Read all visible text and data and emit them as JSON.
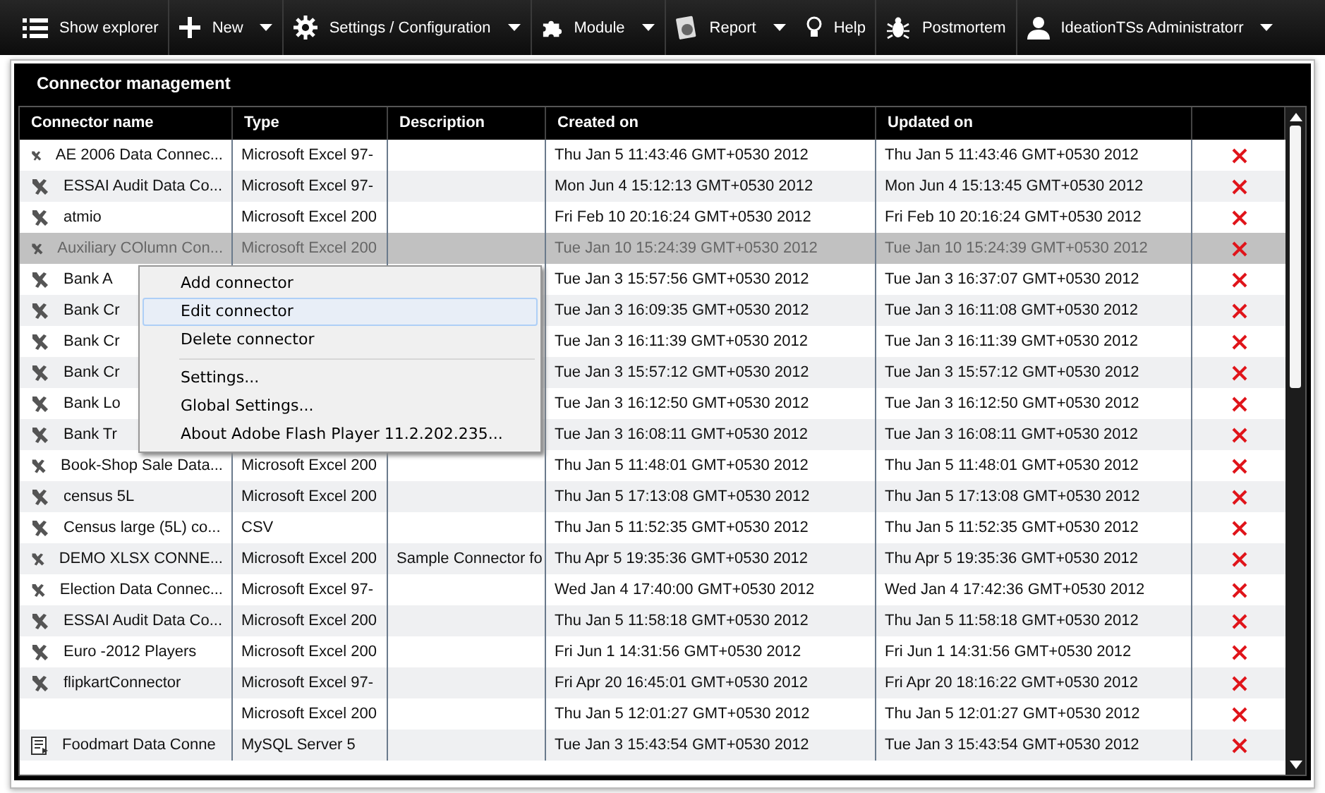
{
  "toolbar": [
    {
      "kind": "list",
      "label": "Show explorer",
      "dropdown": false,
      "separated": true
    },
    {
      "kind": "plus",
      "label": "New",
      "dropdown": true,
      "separated": true
    },
    {
      "kind": "gear",
      "label": "Settings / Configuration",
      "dropdown": true,
      "separated": true
    },
    {
      "kind": "puzzle",
      "label": "Module",
      "dropdown": true,
      "separated": true
    },
    {
      "kind": "report",
      "label": "Report",
      "dropdown": true,
      "separated": false
    },
    {
      "kind": "bulb",
      "label": "Help",
      "dropdown": false,
      "separated": true
    },
    {
      "kind": "bug",
      "label": "Postmortem",
      "dropdown": false,
      "separated": true
    },
    {
      "kind": "user",
      "label": "IdeationTSs Administratorr",
      "dropdown": true,
      "separated": false
    }
  ],
  "panel": {
    "title": "Connector management"
  },
  "table": {
    "columns": [
      "Connector name",
      "Type",
      "Description",
      "Created on",
      "Updated on"
    ],
    "rows": [
      {
        "kind": "plug",
        "name": "AE 2006 Data Connec...",
        "type": "Microsoft Excel 97-",
        "created": "Thu Jan 5 11:43:46 GMT+0530 2012",
        "updated": "Thu Jan 5 11:43:46 GMT+0530 2012",
        "selected": false
      },
      {
        "kind": "plug",
        "name": "ESSAI Audit Data Co...",
        "type": "Microsoft Excel 97-",
        "created": "Mon Jun 4 15:12:13 GMT+0530 2012",
        "updated": "Mon Jun 4 15:13:45 GMT+0530 2012",
        "selected": false
      },
      {
        "kind": "plug",
        "name": "atmio",
        "type": "Microsoft Excel 200",
        "created": "Fri Feb 10 20:16:24 GMT+0530 2012",
        "updated": "Fri Feb 10 20:16:24 GMT+0530 2012",
        "selected": false
      },
      {
        "kind": "plug",
        "name": "Auxiliary COlumn Con...",
        "type": "Microsoft Excel 200",
        "created": "Tue Jan 10 15:24:39 GMT+0530 2012",
        "updated": "Tue Jan 10 15:24:39 GMT+0530 2012",
        "selected": true
      },
      {
        "kind": "plug",
        "name": "Bank A",
        "created": "Tue Jan 3 15:57:56 GMT+0530 2012",
        "updated": "Tue Jan 3 16:37:07 GMT+0530 2012",
        "selected": false
      },
      {
        "kind": "plug",
        "name": "Bank Cr",
        "created": "Tue Jan 3 16:09:35 GMT+0530 2012",
        "updated": "Tue Jan 3 16:11:08 GMT+0530 2012",
        "selected": false
      },
      {
        "kind": "plug",
        "name": "Bank Cr",
        "created": "Tue Jan 3 16:11:39 GMT+0530 2012",
        "updated": "Tue Jan 3 16:11:39 GMT+0530 2012",
        "selected": false
      },
      {
        "kind": "plug",
        "name": "Bank Cr",
        "created": "Tue Jan 3 15:57:12 GMT+0530 2012",
        "updated": "Tue Jan 3 15:57:12 GMT+0530 2012",
        "selected": false
      },
      {
        "kind": "plug",
        "name": "Bank Lo",
        "created": "Tue Jan 3 16:12:50 GMT+0530 2012",
        "updated": "Tue Jan 3 16:12:50 GMT+0530 2012",
        "selected": false
      },
      {
        "kind": "plug",
        "name": "Bank Tr",
        "created": "Tue Jan 3 16:08:11 GMT+0530 2012",
        "updated": "Tue Jan 3 16:08:11 GMT+0530 2012",
        "selected": false
      },
      {
        "kind": "plug",
        "name": "Book-Shop Sale Data...",
        "type": "Microsoft Excel 200",
        "created": "Thu Jan 5 11:48:01 GMT+0530 2012",
        "updated": "Thu Jan 5 11:48:01 GMT+0530 2012",
        "selected": false
      },
      {
        "kind": "plug",
        "name": "census 5L",
        "type": "Microsoft Excel 200",
        "created": "Thu Jan 5 17:13:08 GMT+0530 2012",
        "updated": "Thu Jan 5 17:13:08 GMT+0530 2012",
        "selected": false
      },
      {
        "kind": "plug",
        "name": "Census large (5L) co...",
        "type": "CSV",
        "created": "Thu Jan 5 11:52:35 GMT+0530 2012",
        "updated": "Thu Jan 5 11:52:35 GMT+0530 2012",
        "selected": false
      },
      {
        "kind": "plug",
        "name": "DEMO XLSX CONNE...",
        "type": "Microsoft Excel 200",
        "description": "Sample Connector fo",
        "created": "Thu Apr 5 19:35:36 GMT+0530 2012",
        "updated": "Thu Apr 5 19:35:36 GMT+0530 2012",
        "selected": false
      },
      {
        "kind": "plug",
        "name": "Election Data Connec...",
        "type": "Microsoft Excel 97-",
        "created": "Wed Jan 4 17:40:00 GMT+0530 2012",
        "updated": "Wed Jan 4 17:42:36 GMT+0530 2012",
        "selected": false
      },
      {
        "kind": "plug",
        "name": "ESSAI Audit Data Co...",
        "type": "Microsoft Excel 200",
        "created": "Thu Jan 5 11:58:18 GMT+0530 2012",
        "updated": "Thu Jan 5 11:58:18 GMT+0530 2012",
        "selected": false
      },
      {
        "kind": "plug",
        "name": "Euro -2012 Players",
        "type": "Microsoft Excel 200",
        "created": "Fri Jun 1 14:31:56 GMT+0530 2012",
        "updated": "Fri Jun 1 14:31:56 GMT+0530 2012",
        "selected": false
      },
      {
        "kind": "plug",
        "name": "flipkartConnector",
        "type": "Microsoft Excel 97-",
        "created": "Fri Apr 20 16:45:01 GMT+0530 2012",
        "updated": "Fri Apr 20 18:16:22 GMT+0530 2012",
        "selected": false
      },
      {
        "type": "Microsoft Excel 200",
        "created": "Thu Jan 5 12:01:27 GMT+0530 2012",
        "updated": "Thu Jan 5 12:01:27 GMT+0530 2012",
        "selected": false
      },
      {
        "kind": "doc",
        "name": "Foodmart Data Conne",
        "type": "MySQL Server 5",
        "created": "Tue Jan 3 15:43:54 GMT+0530 2012",
        "updated": "Tue Jan 3 15:43:54 GMT+0530 2012",
        "selected": false
      }
    ]
  },
  "context_menu": {
    "sections": [
      {
        "items": [
          {
            "label": "Add connector",
            "selected": false
          },
          {
            "label": "Edit connector",
            "selected": true
          },
          {
            "label": "Delete connector",
            "selected": false
          }
        ]
      },
      {
        "items": [
          {
            "label": "Settings...",
            "selected": false
          },
          {
            "label": "Global Settings...",
            "selected": false
          },
          {
            "label": "About Adobe Flash Player 11.2.202.235...",
            "selected": false
          }
        ]
      }
    ]
  }
}
